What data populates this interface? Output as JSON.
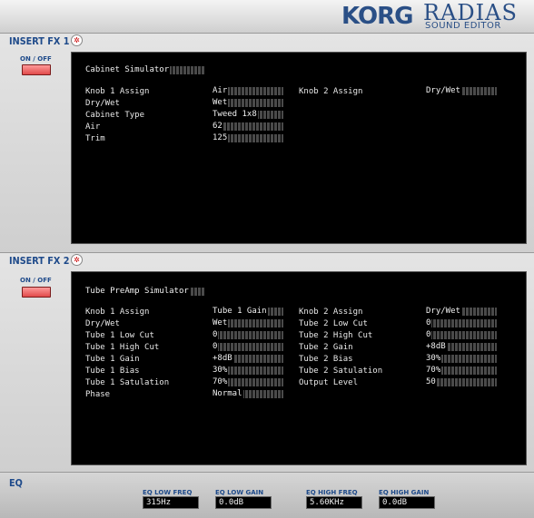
{
  "header": {
    "brand": "KORG",
    "product": "RADIAS",
    "subtitle": "SOUND EDITOR"
  },
  "fx1": {
    "title": "INSERT FX 1",
    "onoff_label": "ON / OFF",
    "effect_name": "Cabinet Simulator",
    "rows": [
      {
        "label": "Knob 1 Assign",
        "value": "Air"
      },
      {
        "label": "Dry/Wet",
        "value": "Wet"
      },
      {
        "label": "Cabinet Type",
        "value": "Tweed 1x8"
      },
      {
        "label": "Air",
        "value": "62"
      },
      {
        "label": "Trim",
        "value": "125"
      }
    ],
    "right_rows": [
      {
        "label": "Knob 2 Assign",
        "value": "Dry/Wet"
      }
    ]
  },
  "fx2": {
    "title": "INSERT FX 2",
    "onoff_label": "ON / OFF",
    "effect_name": "Tube PreAmp Simulator",
    "rows": [
      {
        "label": "Knob 1 Assign",
        "value": "Tube 1 Gain"
      },
      {
        "label": "Dry/Wet",
        "value": "Wet"
      },
      {
        "label": "Tube 1 Low Cut",
        "value": "0"
      },
      {
        "label": "Tube 1 High Cut",
        "value": "0"
      },
      {
        "label": "Tube 1 Gain",
        "value": "+8dB"
      },
      {
        "label": "Tube 1 Bias",
        "value": "30%"
      },
      {
        "label": "Tube 1 Satulation",
        "value": "70%"
      },
      {
        "label": "Phase",
        "value": "Normal"
      }
    ],
    "right_rows": [
      {
        "label": "Knob 2 Assign",
        "value": "Dry/Wet"
      },
      {
        "label": "Tube 2 Low Cut",
        "value": "0"
      },
      {
        "label": "Tube 2 High Cut",
        "value": "0"
      },
      {
        "label": "Tube 2 Gain",
        "value": "+8dB"
      },
      {
        "label": "Tube 2 Bias",
        "value": "30%"
      },
      {
        "label": "Tube 2 Satulation",
        "value": "70%"
      },
      {
        "label": "Output Level",
        "value": "50"
      }
    ]
  },
  "eq": {
    "title": "EQ",
    "low_freq_label": "EQ LOW FREQ",
    "low_freq_value": "315Hz",
    "low_gain_label": "EQ LOW GAIN",
    "low_gain_value": "0.0dB",
    "high_freq_label": "EQ HIGH FREQ",
    "high_freq_value": "5.60KHz",
    "high_gain_label": "EQ HIGH GAIN",
    "high_gain_value": "0.0dB"
  },
  "colors": {
    "accent": "#1e4a8a",
    "lcd_bg": "#000000",
    "lcd_text": "#e8e8e8",
    "onoff": "#e04a4a"
  }
}
